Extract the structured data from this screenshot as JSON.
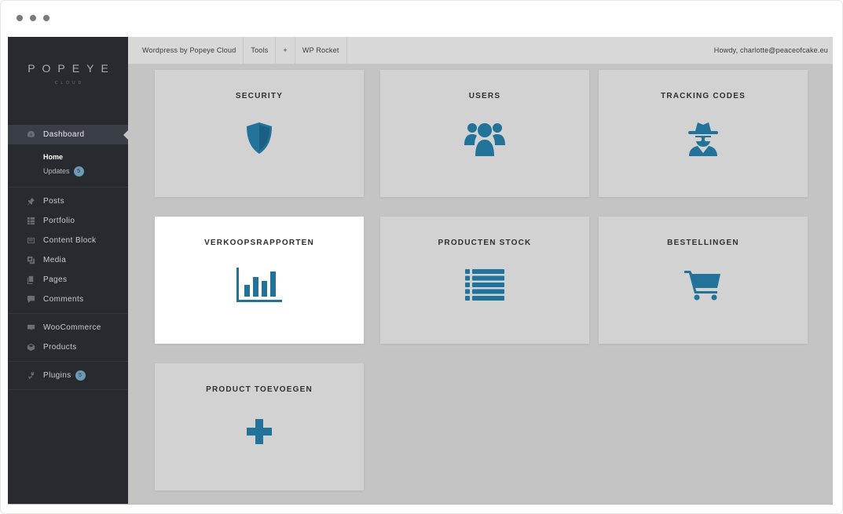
{
  "sidebar": {
    "logo": {
      "brand": "POPEYE",
      "sub": "CLOUD"
    },
    "items": [
      {
        "label": "Dashboard",
        "icon": "dashboard-icon"
      },
      {
        "label": "Posts",
        "icon": "pin-icon"
      },
      {
        "label": "Portfolio",
        "icon": "grid-icon"
      },
      {
        "label": "Content Block",
        "icon": "block-icon"
      },
      {
        "label": "Media",
        "icon": "media-icon"
      },
      {
        "label": "Pages",
        "icon": "pages-icon"
      },
      {
        "label": "Comments",
        "icon": "comment-icon"
      },
      {
        "label": "WooCommerce",
        "icon": "woocommerce-icon"
      },
      {
        "label": "Products",
        "icon": "box-icon"
      },
      {
        "label": "Plugins",
        "icon": "plug-icon",
        "badge": "5"
      }
    ],
    "submenu": [
      {
        "label": "Home"
      },
      {
        "label": "Updates",
        "badge": "5"
      }
    ]
  },
  "topbar": {
    "items": [
      "Wordpress by Popeye Cloud",
      "Tools",
      "+",
      "WP Rocket"
    ],
    "greeting": "Howdy, charlotte@peaceofcake.eu"
  },
  "tiles": [
    {
      "title": "SECURITY",
      "icon": "shield-icon"
    },
    {
      "title": "USERS",
      "icon": "users-icon"
    },
    {
      "title": "TRACKING CODES",
      "icon": "spy-icon"
    },
    {
      "title": "VERKOOPSRAPPORTEN",
      "icon": "bar-chart-icon"
    },
    {
      "title": "PRODUCTEN STOCK",
      "icon": "list-icon"
    },
    {
      "title": "BESTELLINGEN",
      "icon": "cart-icon"
    },
    {
      "title": "PRODUCT TOEVOEGEN",
      "icon": "plus-icon"
    }
  ],
  "colors": {
    "accent": "#23729a",
    "sidebar": "#272b30",
    "badge": "#6f9ab4",
    "content_bg": "#c4c4c4",
    "tile_bg": "#d2d2d2"
  }
}
